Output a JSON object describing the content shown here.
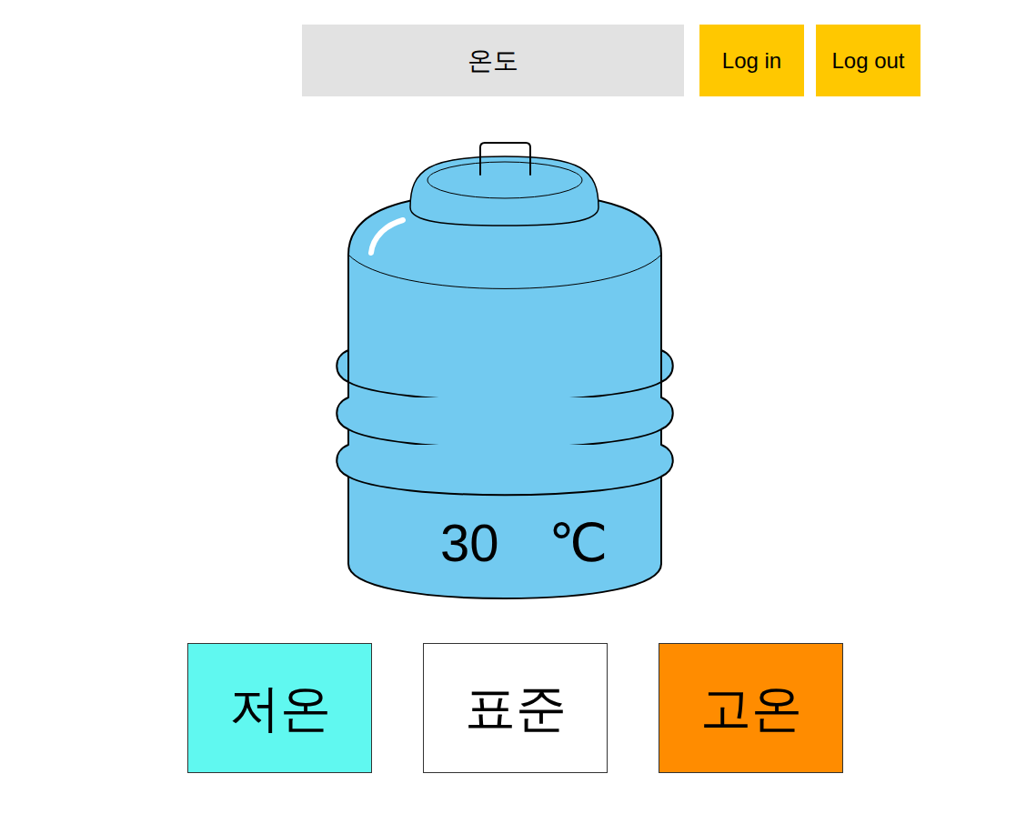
{
  "header": {
    "title": "온도"
  },
  "auth_buttons": [
    {
      "label": "Log in"
    },
    {
      "label": "Log out"
    }
  ],
  "tank": {
    "value": "30",
    "unit": "℃"
  },
  "modes": [
    {
      "label": "저온",
      "color": "#60f8f0"
    },
    {
      "label": "표준",
      "color": "#ffffff"
    },
    {
      "label": "고온",
      "color": "#ff8c00"
    }
  ]
}
